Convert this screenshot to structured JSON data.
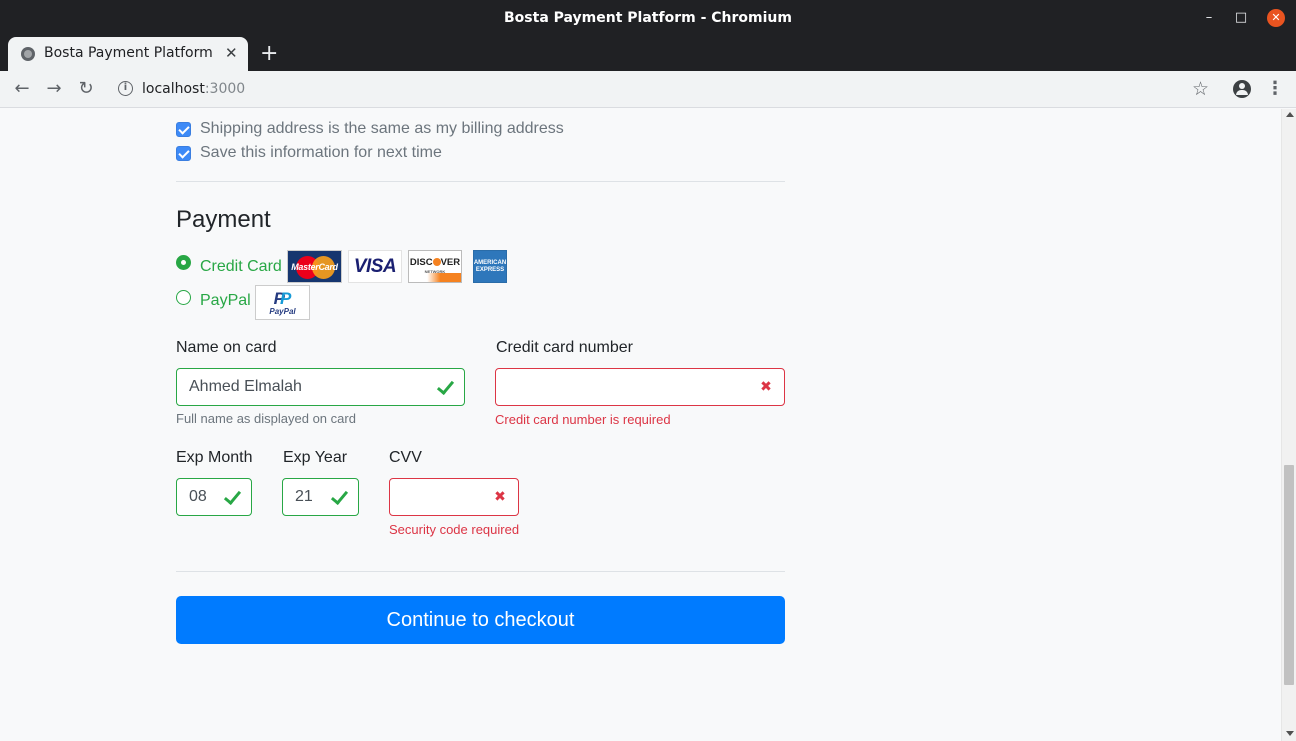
{
  "window": {
    "title": "Bosta Payment Platform - Chromium",
    "minimize_glyph": "–",
    "maximize_glyph": "□",
    "close_glyph": "✕"
  },
  "tab": {
    "title": "Bosta Payment Platform",
    "close_glyph": "✕",
    "new_tab_glyph": "+"
  },
  "toolbar": {
    "back_glyph": "←",
    "forward_glyph": "→",
    "reload_glyph": "↻",
    "info_glyph": "i",
    "url_host": "localhost",
    "url_port": ":3000",
    "star_glyph": "☆",
    "menu_glyph": "⋮"
  },
  "form": {
    "shipping_same_label": "Shipping address is the same as my billing address",
    "shipping_same_checked": true,
    "save_info_label": "Save this information for next time",
    "save_info_checked": true,
    "payment_title": "Payment",
    "payment_methods": [
      {
        "label": "Credit Card",
        "checked": true
      },
      {
        "label": "PayPal",
        "checked": false
      }
    ],
    "card_logos": {
      "mastercard": "MasterCard",
      "visa": "VISA",
      "discover_a": "DISC",
      "discover_b": "VER",
      "discover_net": "NETWORK",
      "amex_a": "AMERICAN",
      "amex_b": "EXPRESS",
      "paypal_a": "P",
      "paypal_b": "P",
      "paypal_word": "PayPal"
    },
    "name_on_card": {
      "label": "Name on card",
      "value": "Ahmed Elmalah",
      "help": "Full name as displayed on card",
      "valid": true
    },
    "card_number": {
      "label": "Credit card number",
      "value": "",
      "error": "Credit card number is required",
      "valid": false
    },
    "exp_month": {
      "label": "Exp Month",
      "value": "08",
      "valid": true
    },
    "exp_year": {
      "label": "Exp Year",
      "value": "21",
      "valid": true
    },
    "cvv": {
      "label": "CVV",
      "value": "",
      "error": "Security code required",
      "valid": false
    },
    "submit_label": "Continue to checkout",
    "error_glyph": "✖"
  },
  "colors": {
    "valid": "#28a745",
    "invalid": "#dc3545",
    "primary": "#007bff"
  }
}
